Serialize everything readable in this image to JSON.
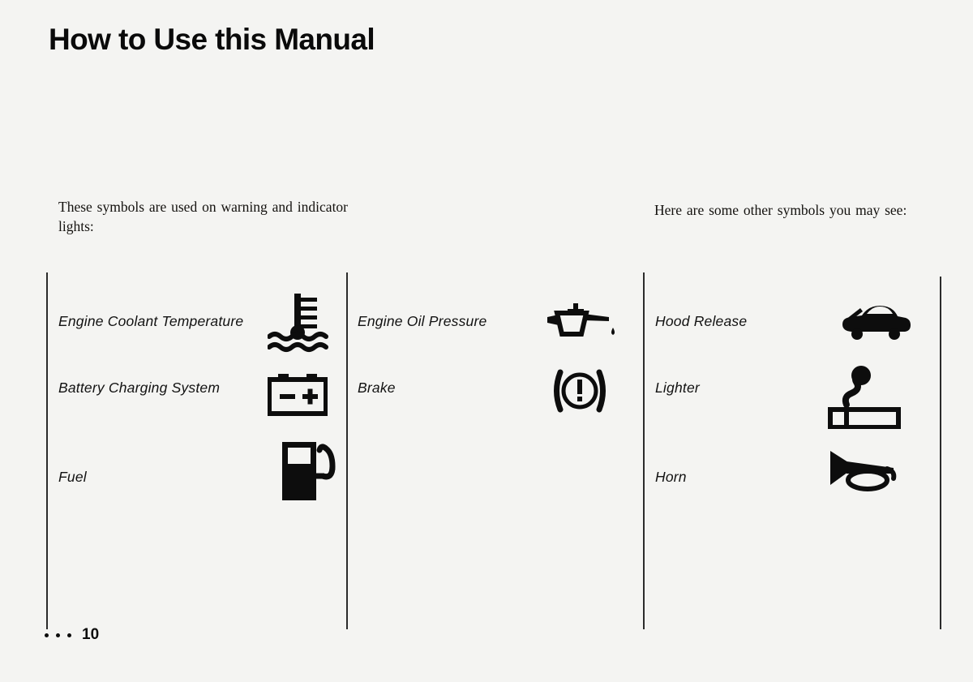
{
  "page": {
    "title": "How to Use this Manual",
    "page_number": "10",
    "footer_dots": 3,
    "ink_color": "#111111",
    "background_color": "#f4f4f2"
  },
  "intro": {
    "left": "These symbols are used on warning and indicator lights:",
    "right": "Here are some other symbols you may see:"
  },
  "columns": [
    {
      "id": "warning-lights-column-1",
      "rows": [
        {
          "label": "Engine Coolant Temperature",
          "icon": "coolant-temperature-icon"
        },
        {
          "label": "Battery Charging System",
          "icon": "battery-charging-icon"
        },
        {
          "label": "Fuel",
          "icon": "fuel-pump-icon"
        }
      ]
    },
    {
      "id": "warning-lights-column-2",
      "rows": [
        {
          "label": "Engine Oil Pressure",
          "icon": "oil-can-icon"
        },
        {
          "label": "Brake",
          "icon": "brake-warning-icon"
        }
      ]
    },
    {
      "id": "other-symbols-column",
      "rows": [
        {
          "label": "Hood Release",
          "icon": "hood-release-car-icon"
        },
        {
          "label": "Lighter",
          "icon": "cigarette-lighter-icon"
        },
        {
          "label": "Horn",
          "icon": "horn-icon"
        }
      ]
    }
  ]
}
